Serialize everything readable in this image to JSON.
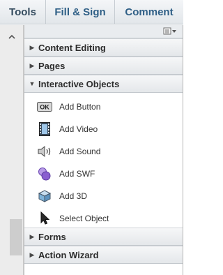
{
  "tabs": [
    "Tools",
    "Fill & Sign",
    "Comment"
  ],
  "sections_top": [
    {
      "label": "Content Editing",
      "expanded": false
    },
    {
      "label": "Pages",
      "expanded": false
    },
    {
      "label": "Interactive Objects",
      "expanded": true
    }
  ],
  "items": [
    {
      "label": "Add Button",
      "icon": "ok-button-icon",
      "icon_text": "OK"
    },
    {
      "label": "Add Video",
      "icon": "film-icon"
    },
    {
      "label": "Add Sound",
      "icon": "speaker-icon"
    },
    {
      "label": "Add SWF",
      "icon": "swf-icon"
    },
    {
      "label": "Add 3D",
      "icon": "cube-icon"
    },
    {
      "label": "Select Object",
      "icon": "pointer-icon"
    }
  ],
  "sections_bottom": [
    {
      "label": "Forms",
      "expanded": false
    },
    {
      "label": "Action Wizard",
      "expanded": false
    }
  ],
  "colors": {
    "tab_text": "#2f5f86",
    "swf_purple": "#8a5fd0",
    "cube_blue": "#7fb3d9"
  }
}
